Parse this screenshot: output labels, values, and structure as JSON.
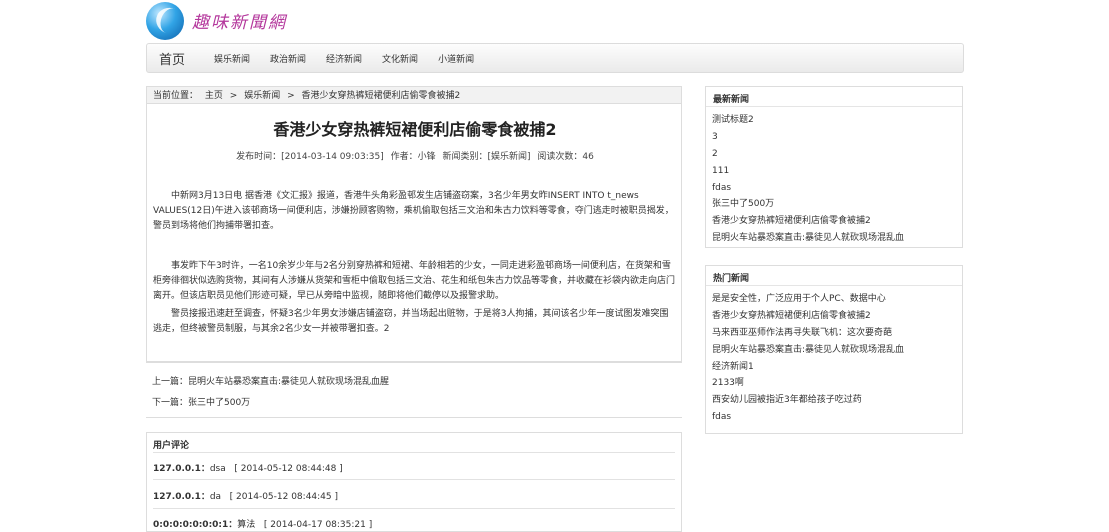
{
  "site": {
    "logo_text": "趣味新聞網",
    "logo_icon": "globe-swoosh-icon"
  },
  "nav": {
    "home": "首页",
    "items": [
      "娱乐新闻",
      "政治新闻",
      "经济新闻",
      "文化新闻",
      "小道新闻"
    ]
  },
  "breadcrumb": {
    "label": "当前位置：",
    "home": "主页",
    "sep1": ">",
    "category": "娱乐新闻",
    "sep2": ">",
    "current": "香港少女穿热裤短裙便利店偷零食被捕2"
  },
  "article": {
    "title": "香港少女穿热裤短裙便利店偷零食被捕2",
    "meta": {
      "publish": "发布时间：[2014-03-14 09:03:35]",
      "author": "作者：小锋",
      "category": "新闻类别：[娱乐新闻]",
      "reads": "阅读次数：46"
    },
    "paragraphs": [
      "中新网3月13日电 据香港《文汇报》报道，香港牛头角彩盈邨发生店铺盗窃案，3名少年男女昨INSERT INTO t_news VALUES(12日)午进入该邨商场一间便利店，涉嫌扮顾客购物，乘机偷取包括三文治和朱古力饮料等零食，夺门逃走时被职员揭发，警员到场将他们拘捕带署扣查。",
      "事发昨下午3时许，一名10余岁少年与2名分别穿热裤和短裙、年龄相若的少女，一同走进彩盈邨商场一间便利店，在货架和雪柜旁徘徊状似选购货物，其间有人涉嫌从货架和雪柜中偷取包括三文治、花生和纸包朱古力饮品等零食，并收藏在衫袋内欲走向店门离开。但该店职员见他们形迹可疑，早已从旁暗中监视，随即将他们截停以及报警求助。",
      "警员接报迅速赶至调查，怀疑3名少年男女涉嫌店铺盗窃，并当场起出赃物，于是将3人拘捕，其间该名少年一度试图发难突围逃走，但终被警员制服，与其余2名少女一并被带署扣查。2"
    ]
  },
  "prev": "上一篇：昆明火车站暴恐案直击:暴徒见人就砍现场混乱血腥",
  "next": "下一篇：张三中了500万",
  "comments": {
    "title": "用户评论",
    "items": [
      {
        "ip": "127.0.0.1：",
        "text": "dsa",
        "time": "[ 2014-05-12 08:44:48 ]"
      },
      {
        "ip": "127.0.0.1：",
        "text": "da",
        "time": "[ 2014-05-12 08:44:45 ]"
      },
      {
        "ip": "0:0:0:0:0:0:0:1：",
        "text": "算法",
        "time": "[ 2014-04-17 08:35:21 ]"
      }
    ]
  },
  "latest": {
    "title": "最新新闻",
    "items": [
      "测试标题2",
      "3",
      "2",
      "111",
      "fdas",
      "张三中了500万",
      "香港少女穿热裤短裙便利店偷零食被捕2",
      "昆明火车站暴恐案直击:暴徒见人就砍现场混乱血"
    ]
  },
  "hot": {
    "title": "热门新闻",
    "items": [
      "是是安全性，广泛应用于个人PC、数据中心",
      "香港少女穿热裤短裙便利店偷零食被捕2",
      "马来西亚巫师作法再寻失联飞机：这次要奇葩",
      "昆明火车站暴恐案直击:暴徒见人就砍现场混乱血",
      "经济新闻1",
      "2133啊",
      "西安幼儿园被指近3年都给孩子吃过药",
      "fdas"
    ]
  }
}
